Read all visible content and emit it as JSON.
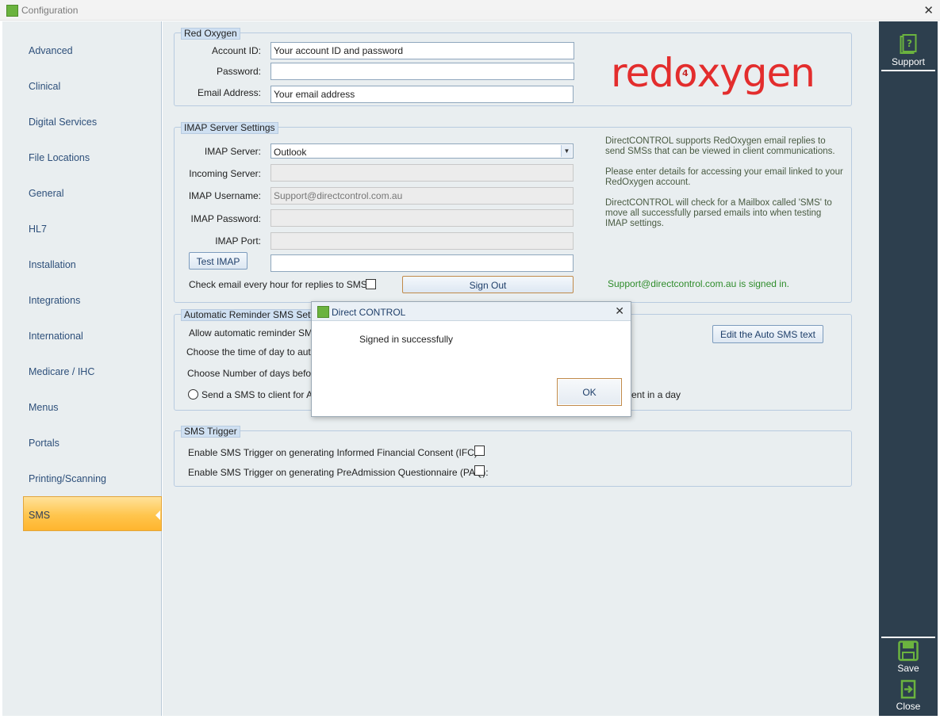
{
  "window": {
    "title": "Configuration",
    "close_glyph": "✕"
  },
  "sidebar": {
    "items": [
      {
        "label": "Advanced"
      },
      {
        "label": "Clinical"
      },
      {
        "label": "Digital Services"
      },
      {
        "label": "File Locations"
      },
      {
        "label": "General"
      },
      {
        "label": "HL7"
      },
      {
        "label": "Installation"
      },
      {
        "label": "Integrations"
      },
      {
        "label": "International"
      },
      {
        "label": "Medicare / IHC"
      },
      {
        "label": "Menus"
      },
      {
        "label": "Portals"
      },
      {
        "label": "Printing/Scanning"
      },
      {
        "label": "SMS"
      }
    ],
    "active": "SMS"
  },
  "red_oxygen": {
    "group_title": "Red Oxygen",
    "account_id_label": "Account ID:",
    "account_id_value": "Your account ID and password",
    "password_label": "Password:",
    "password_value": "",
    "email_label": "Email Address:",
    "email_value": "Your email address",
    "logo_text_before": "red",
    "logo_o": "o",
    "logo_four": "4",
    "logo_text_after": "xygen",
    "logo_color": "#e32d2d"
  },
  "imap": {
    "group_title": "IMAP Server Settings",
    "server_label": "IMAP Server:",
    "server_value": "Outlook",
    "incoming_label": "Incoming Server:",
    "incoming_value": "",
    "username_label": "IMAP Username:",
    "username_value": "Support@directcontrol.com.au",
    "password_label": "IMAP Password:",
    "password_value": "",
    "port_label": "IMAP Port:",
    "port_value": "",
    "test_button": "Test IMAP",
    "test_result": "",
    "check_email_label": "Check email every hour for replies to SMS's",
    "check_email_checked": false,
    "sign_out_button": "Sign Out",
    "info_1_line1": "DirectCONTROL supports RedOxygen email replies to",
    "info_1_line2": "send SMSs that can be viewed in client communications.",
    "info_2_line1": "Please enter details for accessing your email linked to your",
    "info_2_line2": "RedOxygen account.",
    "info_3_line1": "DirectCONTROL will check for a Mailbox called 'SMS' to",
    "info_3_line2": "move all successfully parsed emails into when testing",
    "info_3_line3": "IMAP settings.",
    "signed_in_status": "Support@directcontrol.com.au is signed in.",
    "status_color": "#2f8c2b"
  },
  "auto_reminder": {
    "group_title": "Automatic Reminder SMS Settings",
    "allow_label": "Allow automatic reminder SMS",
    "time_label": "Choose the time of day to auto",
    "days_label": "Choose Number of days before",
    "radio_left_label": "Send a SMS to client for ALL",
    "radio_right_label": "ent in a day",
    "edit_button": "Edit the Auto SMS text"
  },
  "sms_trigger": {
    "group_title": "SMS Trigger",
    "ifc_label": "Enable SMS Trigger on generating Informed Financial Consent (IFC):",
    "ifc_checked": false,
    "paq_label": "Enable SMS Trigger on generating PreAdmission Questionnaire (PAQ):",
    "paq_checked": false
  },
  "right_bar": {
    "support_label": "Support",
    "save_label": "Save",
    "close_label": "Close",
    "icon_color": "#6bb33f"
  },
  "dialog": {
    "title": "Direct CONTROL",
    "close_glyph": "✕",
    "message": "Signed in successfully",
    "ok_button": "OK"
  }
}
